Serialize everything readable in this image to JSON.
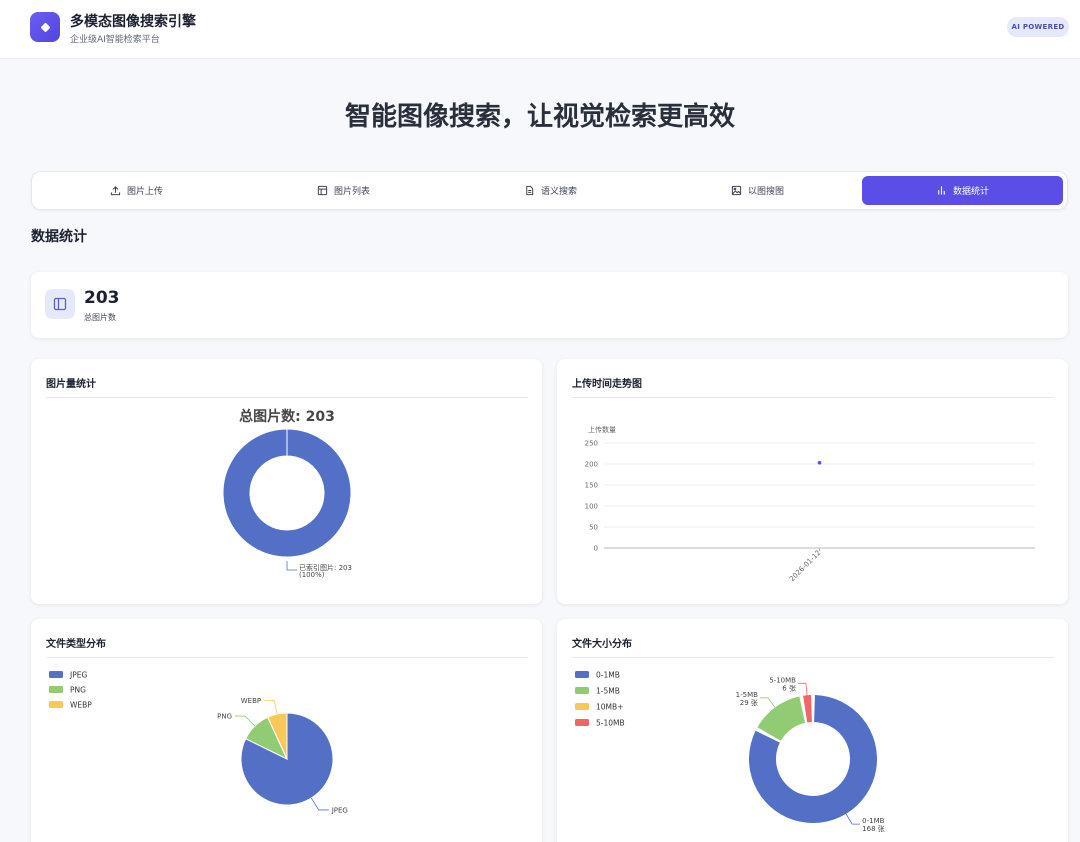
{
  "header": {
    "app_title": "多模态图像搜索引擎",
    "app_subtitle": "企业级AI智能检索平台",
    "badge": "AI POWERED"
  },
  "hero": {
    "title": "智能图像搜索，让视觉检索更高效"
  },
  "tabs": [
    {
      "label": "图片上传",
      "icon": "upload-icon",
      "active": false
    },
    {
      "label": "图片列表",
      "icon": "table-icon",
      "active": false
    },
    {
      "label": "语义搜索",
      "icon": "document-icon",
      "active": false
    },
    {
      "label": "以图搜图",
      "icon": "image-icon",
      "active": false
    },
    {
      "label": "数据统计",
      "icon": "bar-chart-icon",
      "active": true
    }
  ],
  "page": {
    "section_title": "数据统计"
  },
  "summary": {
    "value": "203",
    "label": "总图片数",
    "icon": "panel-icon"
  },
  "colors": {
    "accent": "#5a4ee6",
    "blue": "#5470c6",
    "green": "#91cc75",
    "yellow": "#fac858",
    "red": "#ee6666"
  },
  "cards": {
    "image_count": {
      "title": "图片量统计"
    },
    "upload_trend": {
      "title": "上传时间走势图"
    },
    "file_type": {
      "title": "文件类型分布"
    },
    "file_size": {
      "title": "文件大小分布"
    }
  },
  "chart_data": [
    {
      "type": "pie",
      "variant": "donut",
      "title": "总图片数: 203",
      "slices": [
        {
          "name": "已索引图片",
          "value": 203,
          "percent": "100%"
        }
      ],
      "label_text": [
        "已索引图片: 203",
        "(100%)"
      ]
    },
    {
      "type": "line",
      "ylabel": "上传数量",
      "ylim": [
        0,
        250
      ],
      "yticks": [
        0,
        50,
        100,
        150,
        200,
        250
      ],
      "x": [
        "2026-01-12"
      ],
      "x_tick_label": "2026-01-12",
      "series": [
        {
          "values": [
            203
          ]
        }
      ],
      "grid": true
    },
    {
      "type": "pie",
      "legend": [
        "JPEG",
        "PNG",
        "WEBP"
      ],
      "legend_position": "top-left",
      "slices": [
        {
          "name": "JPEG",
          "value": 167
        },
        {
          "name": "PNG",
          "value": 22
        },
        {
          "name": "WEBP",
          "value": 14
        }
      ]
    },
    {
      "type": "pie",
      "variant": "donut",
      "legend": [
        "0-1MB",
        "1-5MB",
        "10MB+",
        "5-10MB"
      ],
      "legend_position": "top-left",
      "slices": [
        {
          "name": "0-1MB",
          "value": 168,
          "label": "168 张"
        },
        {
          "name": "1-5MB",
          "value": 29,
          "label": "29 张"
        },
        {
          "name": "10MB+",
          "value": 0,
          "label": ""
        },
        {
          "name": "5-10MB",
          "value": 6,
          "label": "6 张"
        }
      ]
    }
  ]
}
